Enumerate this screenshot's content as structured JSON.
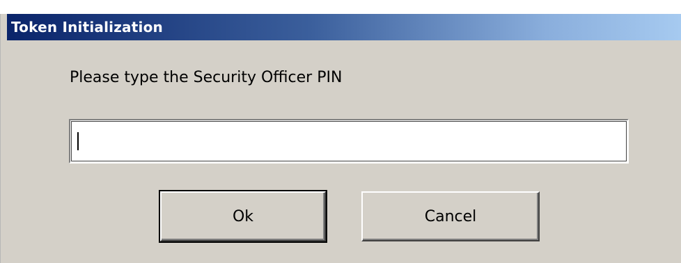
{
  "dialog": {
    "title": "Token Initialization",
    "prompt": "Please type the Security Officer PIN",
    "pin_field": {
      "value": "",
      "placeholder": ""
    },
    "buttons": {
      "ok_label": "Ok",
      "cancel_label": "Cancel"
    }
  },
  "colors": {
    "title_gradient_start": "#0a246a",
    "title_gradient_end": "#a6caf0",
    "face": "#d4d0c8"
  }
}
